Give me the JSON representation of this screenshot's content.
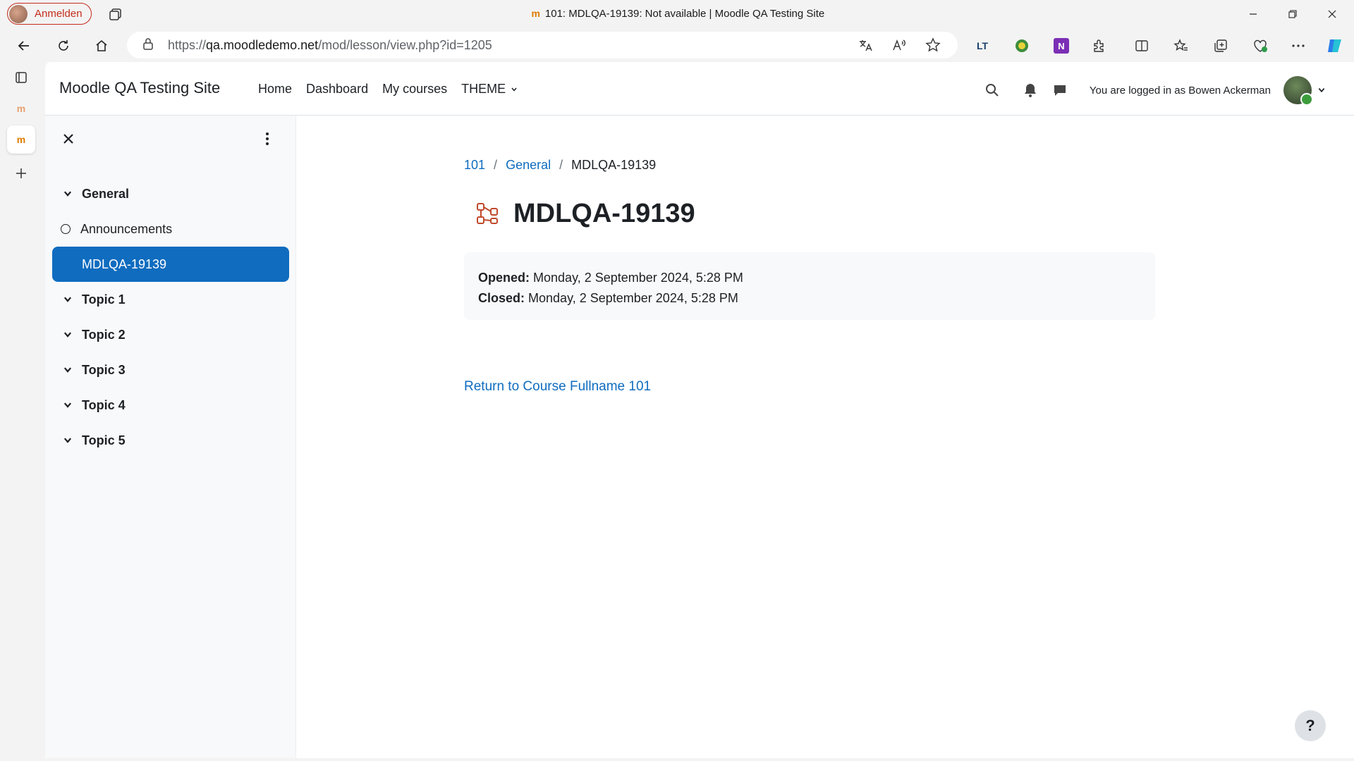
{
  "browser": {
    "profile_label": "Anmelden",
    "window_title": "101: MDLQA-19139: Not available | Moodle QA Testing Site",
    "url_prefix": "https://",
    "url_host": "qa.moodledemo.net",
    "url_path": "/mod/lesson/view.php?id=1205",
    "ext_lt_label": "LT",
    "ext_onenote_label": "N"
  },
  "site": {
    "name": "Moodle QA Testing Site",
    "nav": {
      "home": "Home",
      "dashboard": "Dashboard",
      "my_courses": "My courses",
      "theme": "THEME"
    },
    "logged_in_text": "You are logged in as Bowen Ackerman"
  },
  "course_index": {
    "sections": [
      {
        "title": "General"
      },
      {
        "title": "Topic 1"
      },
      {
        "title": "Topic 2"
      },
      {
        "title": "Topic 3"
      },
      {
        "title": "Topic 4"
      },
      {
        "title": "Topic 5"
      }
    ],
    "general_activities": [
      {
        "label": "Announcements"
      },
      {
        "label": "MDLQA-19139"
      }
    ]
  },
  "main": {
    "breadcrumb": [
      "101",
      "General",
      "MDLQA-19139"
    ],
    "breadcrumb_sep": "/",
    "title": "MDLQA-19139",
    "opened_label": "Opened:",
    "opened_value": "Monday, 2 September 2024, 5:28 PM",
    "closed_label": "Closed:",
    "closed_value": "Monday, 2 September 2024, 5:28 PM",
    "return_link": "Return to Course Fullname 101"
  },
  "help_label": "?",
  "colors": {
    "accent": "#0f6cbf",
    "profile_red": "#c42b1c",
    "module_icon": "#c04a2b"
  }
}
